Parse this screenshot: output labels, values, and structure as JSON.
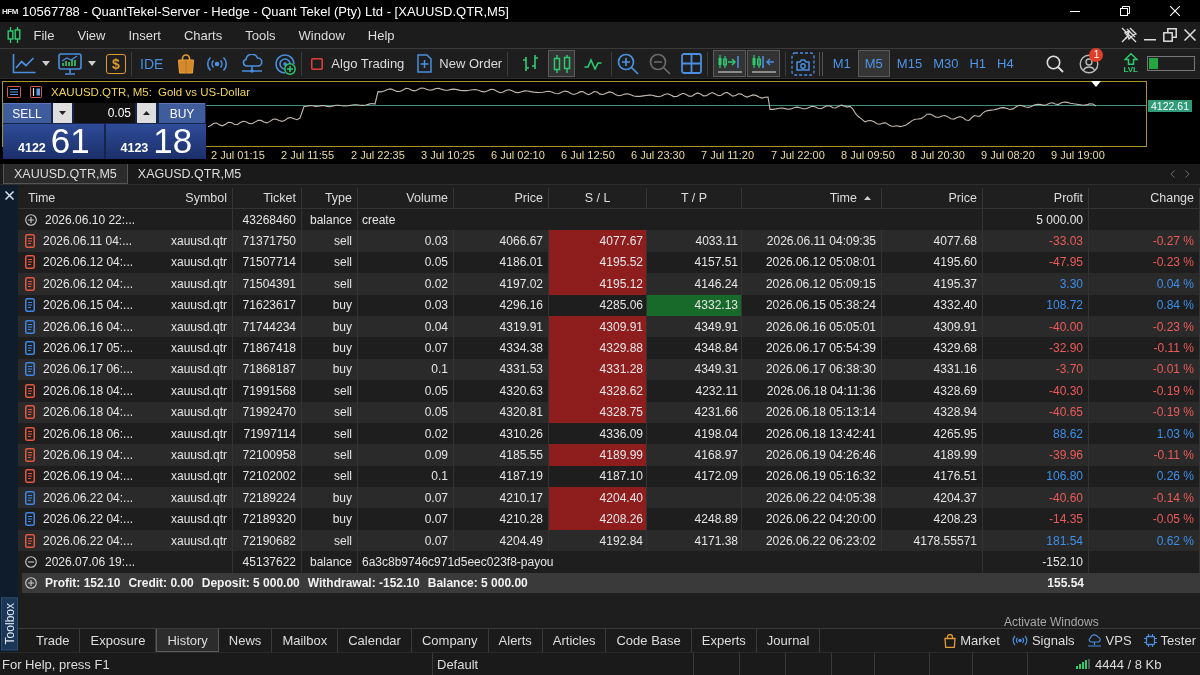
{
  "window": {
    "logo": "HFM",
    "title": "10567788 - QuantTekel-Server - Hedge - Quant Tekel (Pty) Ltd - [XAUUSD.QTR,M5]"
  },
  "menu": [
    "File",
    "View",
    "Insert",
    "Charts",
    "Tools",
    "Window",
    "Help"
  ],
  "toolbar": {
    "currency_glyph": "$",
    "ide": "IDE",
    "algo_trading": {
      "label": "Algo Trading",
      "on": false
    },
    "new_order": "New Order",
    "chart_types": [
      {
        "selected": false
      },
      {
        "selected": true
      },
      {
        "selected": false
      }
    ],
    "zoom_out": {
      "disabled": true
    },
    "chart_shift": {
      "on": true
    },
    "auto_scroll": {
      "on": true
    },
    "timeframes": [
      {
        "label": "M1",
        "selected": false
      },
      {
        "label": "M5",
        "selected": true
      },
      {
        "label": "M15",
        "selected": false
      },
      {
        "label": "M30",
        "selected": false
      },
      {
        "label": "H1",
        "selected": false
      },
      {
        "label": "H4",
        "selected": false
      }
    ],
    "notification_count": "1",
    "lvl": "LVL",
    "meter": {
      "level": 0.2
    }
  },
  "chart": {
    "symbol": "XAUUSD.QTR, M5:",
    "description": "Gold vs US-Dollar",
    "one_click": {
      "sell": "SELL",
      "buy": "BUY",
      "volume": "0.05",
      "bid_head": "4122",
      "bid_tail": "61",
      "ask_head": "4123",
      "ask_tail": "18"
    },
    "price_label": "4122.61",
    "time_labels": [
      "2 Jul 01:15",
      "2 Jul 11:55",
      "2 Jul 22:35",
      "3 Jul 10:25",
      "6 Jul 02:10",
      "6 Jul 12:50",
      "6 Jul 23:30",
      "7 Jul 11:20",
      "7 Jul 22:00",
      "8 Jul 09:50",
      "8 Jul 20:30",
      "9 Jul 08:20",
      "9 Jul 19:00"
    ]
  },
  "chart_tabs": [
    {
      "label": "XAUUSD.QTR,M5",
      "selected": true
    },
    {
      "label": "XAGUSD.QTR,M5",
      "selected": false
    }
  ],
  "history": {
    "columns": [
      {
        "label": "Time",
        "sorted": false
      },
      {
        "label": "Symbol",
        "sorted": false
      },
      {
        "label": "Ticket",
        "sorted": false
      },
      {
        "label": "Type",
        "sorted": false
      },
      {
        "label": "Volume",
        "sorted": false
      },
      {
        "label": "Price",
        "sorted": false
      },
      {
        "label": "S / L",
        "sorted": false
      },
      {
        "label": "T / P",
        "sorted": false
      },
      {
        "label": "Time",
        "sorted": true
      },
      {
        "label": "Price",
        "sorted": false
      },
      {
        "label": "Profit",
        "sorted": false
      },
      {
        "label": "Change",
        "sorted": false
      }
    ],
    "rows": [
      {
        "kind": "deposit",
        "time": "2026.06.10 22:...",
        "ticket": "43268460",
        "type": "balance",
        "comment": "create",
        "profit": "5 000.00"
      },
      {
        "kind": "sell",
        "time": "2026.06.11 04:...",
        "symbol": "xauusd.qtr",
        "ticket": "71371750",
        "type": "sell",
        "volume": "0.03",
        "price": "4066.67",
        "sl": "4077.67",
        "sl_hit": true,
        "tp": "4033.11",
        "tp_hit": false,
        "close_time": "2026.06.11 04:09:35",
        "close_price": "4077.68",
        "profit": "-33.03",
        "change": "-0.27 %",
        "loss": true
      },
      {
        "kind": "sell",
        "time": "2026.06.12 04:...",
        "symbol": "xauusd.qtr",
        "ticket": "71507714",
        "type": "sell",
        "volume": "0.05",
        "price": "4186.01",
        "sl": "4195.52",
        "sl_hit": true,
        "tp": "4157.51",
        "tp_hit": false,
        "close_time": "2026.06.12 05:08:01",
        "close_price": "4195.60",
        "profit": "-47.95",
        "change": "-0.23 %",
        "loss": true
      },
      {
        "kind": "sell",
        "time": "2026.06.12 04:...",
        "symbol": "xauusd.qtr",
        "ticket": "71504391",
        "type": "sell",
        "volume": "0.02",
        "price": "4197.02",
        "sl": "4195.12",
        "sl_hit": true,
        "tp": "4146.24",
        "tp_hit": false,
        "close_time": "2026.06.12 05:09:15",
        "close_price": "4195.37",
        "profit": "3.30",
        "change": "0.04 %",
        "loss": false
      },
      {
        "kind": "buy",
        "time": "2026.06.15 04:...",
        "symbol": "xauusd.qtr",
        "ticket": "71623617",
        "type": "buy",
        "volume": "0.03",
        "price": "4296.16",
        "sl": "4285.06",
        "sl_hit": false,
        "tp": "4332.13",
        "tp_hit": true,
        "close_time": "2026.06.15 05:38:24",
        "close_price": "4332.40",
        "profit": "108.72",
        "change": "0.84 %",
        "loss": false
      },
      {
        "kind": "buy",
        "time": "2026.06.16 04:...",
        "symbol": "xauusd.qtr",
        "ticket": "71744234",
        "type": "buy",
        "volume": "0.04",
        "price": "4319.91",
        "sl": "4309.91",
        "sl_hit": true,
        "tp": "4349.91",
        "tp_hit": false,
        "close_time": "2026.06.16 05:05:01",
        "close_price": "4309.91",
        "profit": "-40.00",
        "change": "-0.23 %",
        "loss": true
      },
      {
        "kind": "buy",
        "time": "2026.06.17 05:...",
        "symbol": "xauusd.qtr",
        "ticket": "71867418",
        "type": "buy",
        "volume": "0.07",
        "price": "4334.38",
        "sl": "4329.88",
        "sl_hit": true,
        "tp": "4348.84",
        "tp_hit": false,
        "close_time": "2026.06.17 05:54:39",
        "close_price": "4329.68",
        "profit": "-32.90",
        "change": "-0.11 %",
        "loss": true
      },
      {
        "kind": "buy",
        "time": "2026.06.17 06:...",
        "symbol": "xauusd.qtr",
        "ticket": "71868187",
        "type": "buy",
        "volume": "0.1",
        "price": "4331.53",
        "sl": "4331.28",
        "sl_hit": true,
        "tp": "4349.31",
        "tp_hit": false,
        "close_time": "2026.06.17 06:38:30",
        "close_price": "4331.16",
        "profit": "-3.70",
        "change": "-0.01 %",
        "loss": true
      },
      {
        "kind": "sell",
        "time": "2026.06.18 04:...",
        "symbol": "xauusd.qtr",
        "ticket": "71991568",
        "type": "sell",
        "volume": "0.05",
        "price": "4320.63",
        "sl": "4328.62",
        "sl_hit": true,
        "tp": "4232.11",
        "tp_hit": false,
        "close_time": "2026.06.18 04:11:36",
        "close_price": "4328.69",
        "profit": "-40.30",
        "change": "-0.19 %",
        "loss": true
      },
      {
        "kind": "sell",
        "time": "2026.06.18 04:...",
        "symbol": "xauusd.qtr",
        "ticket": "71992470",
        "type": "sell",
        "volume": "0.05",
        "price": "4320.81",
        "sl": "4328.75",
        "sl_hit": true,
        "tp": "4231.66",
        "tp_hit": false,
        "close_time": "2026.06.18 05:13:14",
        "close_price": "4328.94",
        "profit": "-40.65",
        "change": "-0.19 %",
        "loss": true
      },
      {
        "kind": "sell",
        "time": "2026.06.18 06:...",
        "symbol": "xauusd.qtr",
        "ticket": "71997114",
        "type": "sell",
        "volume": "0.02",
        "price": "4310.26",
        "sl": "4336.09",
        "sl_hit": false,
        "tp": "4198.04",
        "tp_hit": false,
        "close_time": "2026.06.18 13:42:41",
        "close_price": "4265.95",
        "profit": "88.62",
        "change": "1.03 %",
        "loss": false
      },
      {
        "kind": "sell",
        "time": "2026.06.19 04:...",
        "symbol": "xauusd.qtr",
        "ticket": "72100958",
        "type": "sell",
        "volume": "0.09",
        "price": "4185.55",
        "sl": "4189.99",
        "sl_hit": true,
        "tp": "4168.97",
        "tp_hit": false,
        "close_time": "2026.06.19 04:26:46",
        "close_price": "4189.99",
        "profit": "-39.96",
        "change": "-0.11 %",
        "loss": true
      },
      {
        "kind": "sell",
        "time": "2026.06.19 04:...",
        "symbol": "xauusd.qtr",
        "ticket": "72102002",
        "type": "sell",
        "volume": "0.1",
        "price": "4187.19",
        "sl": "4187.10",
        "sl_hit": false,
        "tp": "4172.09",
        "tp_hit": false,
        "close_time": "2026.06.19 05:16:32",
        "close_price": "4176.51",
        "profit": "106.80",
        "change": "0.26 %",
        "loss": false
      },
      {
        "kind": "buy",
        "time": "2026.06.22 04:...",
        "symbol": "xauusd.qtr",
        "ticket": "72189224",
        "type": "buy",
        "volume": "0.07",
        "price": "4210.17",
        "sl": "4204.40",
        "sl_hit": true,
        "tp_hit": false,
        "close_time": "2026.06.22 04:05:38",
        "close_price": "4204.37",
        "profit": "-40.60",
        "change": "-0.14 %",
        "loss": true
      },
      {
        "kind": "buy",
        "time": "2026.06.22 04:...",
        "symbol": "xauusd.qtr",
        "ticket": "72189320",
        "type": "buy",
        "volume": "0.07",
        "price": "4210.28",
        "sl": "4208.26",
        "sl_hit": true,
        "tp": "4248.89",
        "tp_hit": false,
        "close_time": "2026.06.22 04:20:00",
        "close_price": "4208.23",
        "profit": "-14.35",
        "change": "-0.05 %",
        "loss": true
      },
      {
        "kind": "sell",
        "time": "2026.06.22 04:...",
        "symbol": "xauusd.qtr",
        "ticket": "72190682",
        "type": "sell",
        "volume": "0.07",
        "price": "4204.49",
        "sl": "4192.84",
        "sl_hit": false,
        "tp": "4171.38",
        "tp_hit": false,
        "close_time": "2026.06.22 06:23:02",
        "close_price": "4178.55571",
        "profit": "181.54",
        "change": "0.62 %",
        "loss": false
      },
      {
        "kind": "withdrawal",
        "time": "2026.07.06 19:...",
        "ticket": "45137622",
        "type": "balance",
        "comment": "6a3c8b9746c971d5eec023f8-payou",
        "profit": "-152.10"
      }
    ],
    "summary": {
      "items": [
        "Profit: 152.10",
        "Credit: 0.00",
        "Deposit: 5 000.00",
        "Withdrawal: -152.10",
        "Balance: 5 000.00"
      ],
      "total": "155.54"
    }
  },
  "toolbox": {
    "label": "Toolbox",
    "notice": "Activate Windows",
    "tabs": [
      {
        "label": "Trade",
        "selected": false
      },
      {
        "label": "Exposure",
        "selected": false
      },
      {
        "label": "History",
        "selected": true
      },
      {
        "label": "News",
        "selected": false
      },
      {
        "label": "Mailbox",
        "selected": false
      },
      {
        "label": "Calendar",
        "selected": false
      },
      {
        "label": "Company",
        "selected": false
      },
      {
        "label": "Alerts",
        "selected": false
      },
      {
        "label": "Articles",
        "selected": false
      },
      {
        "label": "Code Base",
        "selected": false
      },
      {
        "label": "Experts",
        "selected": false
      },
      {
        "label": "Journal",
        "selected": false
      }
    ],
    "services": [
      "Market",
      "Signals",
      "VPS",
      "Tester"
    ]
  },
  "status_bar": {
    "help": "For Help, press F1",
    "profile": "Default",
    "traffic": "4444 / 8 Kb"
  }
}
